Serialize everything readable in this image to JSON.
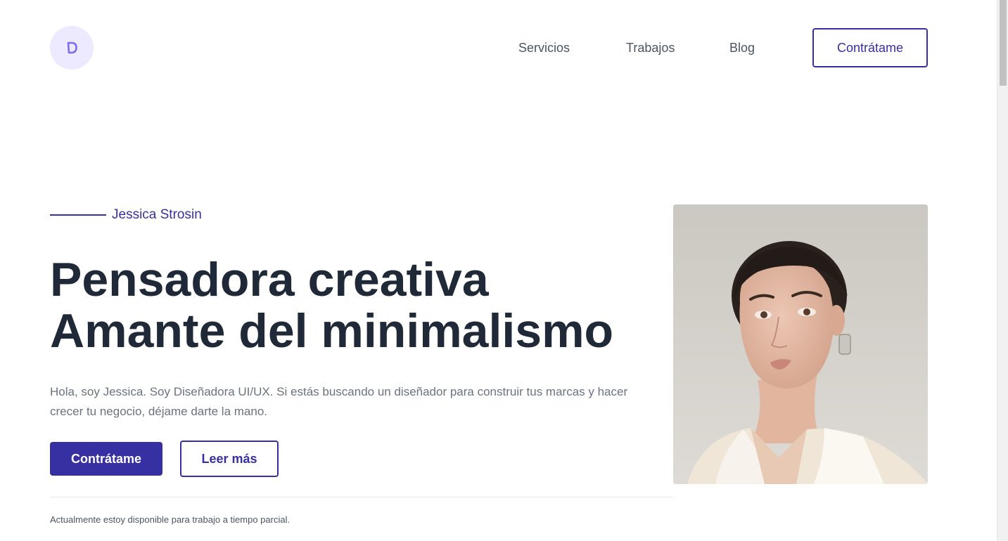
{
  "header": {
    "logo_icon": "brand-d-icon",
    "nav": [
      {
        "label": "Servicios"
      },
      {
        "label": "Trabajos"
      },
      {
        "label": "Blog"
      }
    ],
    "cta_label": "Contrátame"
  },
  "hero": {
    "name": "Jessica Strosin",
    "headline_line1": "Pensadora creativa",
    "headline_line2": "Amante del minimalismo",
    "intro": "Hola, soy Jessica. Soy Diseñadora UI/UX. Si estás buscando un diseñador para construir tus marcas y hacer crecer tu negocio, déjame darte la mano.",
    "primary_button": "Contrátame",
    "secondary_button": "Leer más",
    "availability": "Actualmente estoy disponible para trabajo a tiempo parcial."
  },
  "colors": {
    "accent": "#3730a3",
    "heading": "#1f2937",
    "body_text": "#6b7280",
    "logo_bg": "#ede9fe"
  }
}
